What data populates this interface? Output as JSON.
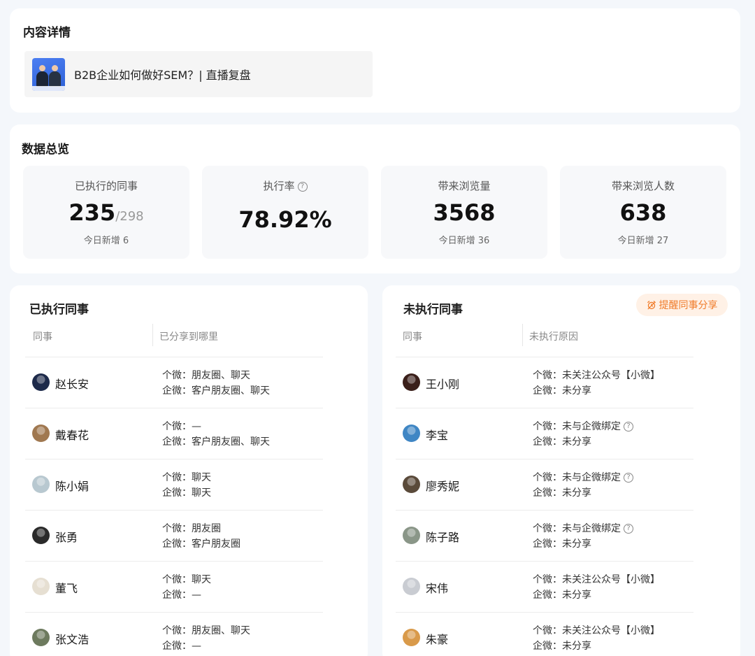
{
  "content_details": {
    "title": "内容详情",
    "item_title": "B2B企业如何做好SEM？| 直播复盘"
  },
  "overview": {
    "title": "数据总览",
    "stats": [
      {
        "label": "已执行的同事",
        "value": "235",
        "total": "/298",
        "sub": "今日新增  6"
      },
      {
        "label": "执行率",
        "value": "78.92%",
        "help": "?"
      },
      {
        "label": "带来浏览量",
        "value": "3568",
        "sub": "今日新增  36"
      },
      {
        "label": "带来浏览人数",
        "value": "638",
        "sub": "今日新增  27"
      }
    ]
  },
  "executed": {
    "title": "已执行同事",
    "col_colleague": "同事",
    "col_shared_to": "已分享到哪里",
    "rows": [
      {
        "name": "赵长安",
        "line1": "个微：朋友圈、聊天",
        "line2": "企微：客户朋友圈、聊天",
        "avatar_color": "#1d2a4a"
      },
      {
        "name": "戴春花",
        "line1": "个微：—",
        "line2": "企微：客户朋友圈、聊天",
        "avatar_color": "#a07850"
      },
      {
        "name": "陈小娟",
        "line1": "个微：聊天",
        "line2": "企微：聊天",
        "avatar_color": "#b8c8d0"
      },
      {
        "name": "张勇",
        "line1": "个微：朋友圈",
        "line2": "企微：客户朋友圈",
        "avatar_color": "#2a2a2a"
      },
      {
        "name": "董飞",
        "line1": "个微：聊天",
        "line2": "企微：—",
        "avatar_color": "#e6dfd2"
      },
      {
        "name": "张文浩",
        "line1": "个微：朋友圈、聊天",
        "line2": "企微：—",
        "avatar_color": "#6d7a5e"
      }
    ]
  },
  "not_executed": {
    "title": "未执行同事",
    "remind_button": "提醒同事分享",
    "col_colleague": "同事",
    "col_reason": "未执行原因",
    "rows": [
      {
        "name": "王小刚",
        "line1": "个微：未关注公众号【小微】",
        "line2": "企微：未分享",
        "help": false,
        "avatar_color": "#3a1f1a"
      },
      {
        "name": "李宝",
        "line1": "个微：未与企微绑定",
        "line2": "企微：未分享",
        "help": true,
        "avatar_color": "#3f86c4"
      },
      {
        "name": "廖秀妮",
        "line1": "个微：未与企微绑定",
        "line2": "企微：未分享",
        "help": true,
        "avatar_color": "#5a4a3a"
      },
      {
        "name": "陈子路",
        "line1": "个微：未与企微绑定",
        "line2": "企微：未分享",
        "help": true,
        "avatar_color": "#8a9688"
      },
      {
        "name": "宋伟",
        "line1": "个微：未关注公众号【小微】",
        "line2": "企微：未分享",
        "help": false,
        "avatar_color": "#c9ccd2"
      },
      {
        "name": "朱豪",
        "line1": "个微：未关注公众号【小微】",
        "line2": "企微：未分享",
        "help": false,
        "avatar_color": "#d99a4a"
      }
    ]
  }
}
